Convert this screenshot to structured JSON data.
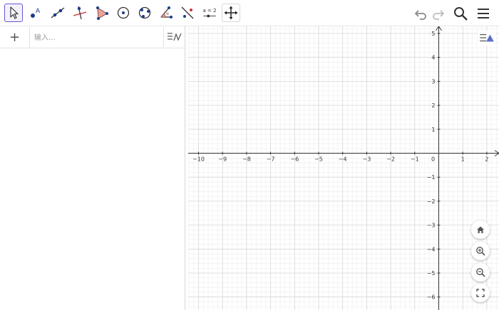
{
  "toolbar": {
    "tools": [
      {
        "name": "move-tool",
        "selected": true
      },
      {
        "name": "point-tool",
        "point_label": "A"
      },
      {
        "name": "line-tool"
      },
      {
        "name": "perpendicular-line-tool"
      },
      {
        "name": "polygon-tool"
      },
      {
        "name": "circle-center-point-tool"
      },
      {
        "name": "circle-three-points-tool"
      },
      {
        "name": "angle-tool",
        "angle_label": "α"
      },
      {
        "name": "reflect-tool"
      },
      {
        "name": "slider-tool",
        "slider_label": "a = 2"
      },
      {
        "name": "move-graphics-view-tool"
      }
    ],
    "right_icons": [
      "undo-icon",
      "redo-icon",
      "search-icon",
      "menu-icon"
    ]
  },
  "algebra": {
    "add_label": "+",
    "input_placeholder": "输入...",
    "input_value": ""
  },
  "graphics": {
    "x_ticks": [
      "−10",
      "−9",
      "−8",
      "−7",
      "−6",
      "−5",
      "−4",
      "−3",
      "−2",
      "−1",
      "0",
      "1",
      "2"
    ],
    "y_ticks_positive": [
      "5",
      "4",
      "3",
      "2",
      "1"
    ],
    "y_ticks_negative": [
      "−1",
      "−2",
      "−3",
      "−4",
      "−5",
      "−6"
    ],
    "origin_label": "0",
    "x_range": [
      -10,
      2
    ],
    "y_range": [
      -6,
      5
    ],
    "grid": true,
    "zoom_buttons": [
      "home-icon",
      "zoom-in-icon",
      "zoom-out-icon",
      "fullscreen-icon"
    ]
  },
  "colors": {
    "accent": "#6557d2",
    "point": "#1565c0",
    "polygon": "#e8a59a",
    "line_red": "#d32f2f",
    "grid_major": "#d6d6d6",
    "grid_minor": "#eeeeee"
  }
}
